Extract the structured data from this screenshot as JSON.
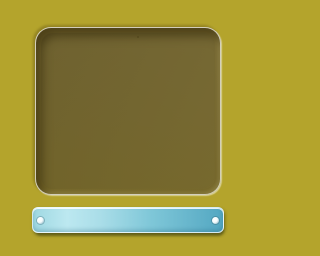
{
  "display": {
    "text": ""
  },
  "name_plate": {
    "text": ""
  },
  "colors": {
    "background": "#b4a42c",
    "panel": "#786a34",
    "plate_start": "#9fd8e2",
    "plate_end": "#53a7c2",
    "screw": "#f4fbfd"
  },
  "icons": {
    "left_screw": "screw-icon",
    "right_screw": "screw-icon"
  }
}
